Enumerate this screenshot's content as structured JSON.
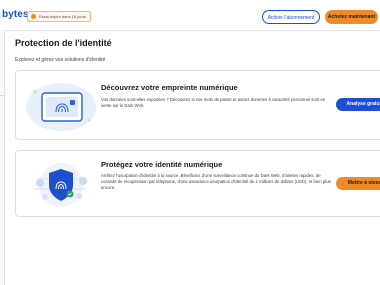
{
  "header": {
    "brand": "bytes",
    "trial_badge": "Essai expiré dans 18 jours",
    "activate_label": "Activer l'abonnement",
    "buy_label": "Achetez maintenant"
  },
  "main": {
    "title": "Protection de l'identité",
    "subtitle": "Explorez et gérez vos solutions d'identité",
    "cards": [
      {
        "title": "Découvrez votre empreinte numérique",
        "description": "Vos données sont-elles exposées ? Découvrez si vos mots de passe et autres données à caractère personnel sont en vente sur le Dark Web.",
        "button_label": "Analyse gratuite"
      },
      {
        "title": "Protégez votre identité numérique",
        "description": "Arrêtez l'usurpation d'identité à la source. Bénéficiez d'une surveillance continue du Dark Web, d'alertes rapides, de conseils de récupération par téléphone, d'une assurance usurpation d'identité de 2 millions de dollars (USD), et bien plus encore.",
        "button_label": "Mettre à niveau"
      }
    ]
  },
  "colors": {
    "brand_blue": "#1a4fd6",
    "accent_orange": "#f28a24"
  },
  "icons": [
    "fingerprint-card-icon",
    "shield-fingerprint-icon",
    "trial-status-dot-icon"
  ]
}
